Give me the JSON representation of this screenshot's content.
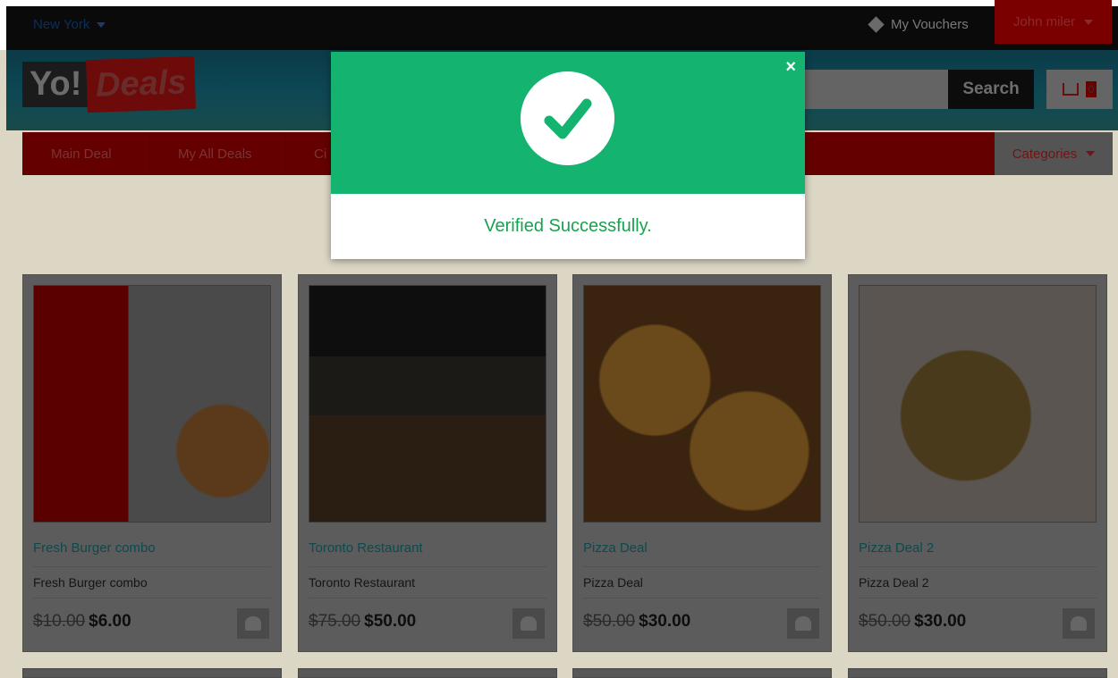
{
  "topbar": {
    "city": "New York",
    "vouchers": "My Vouchers",
    "user": "John miler"
  },
  "header": {
    "logo_yo": "Yo!",
    "logo_deals": "Deals",
    "search_label": "Search",
    "cart_count": "0"
  },
  "nav": {
    "items": [
      "Main Deal",
      "My All Deals",
      "Ci"
    ],
    "categories": "Categories"
  },
  "modal": {
    "close": "×",
    "message": "Verified Successfully."
  },
  "deals": [
    {
      "title": "Fresh Burger combo",
      "subtitle": "Fresh Burger combo",
      "old_price": "$10.00",
      "new_price": "$6.00"
    },
    {
      "title": "Toronto Restaurant",
      "subtitle": "Toronto Restaurant",
      "old_price": "$75.00",
      "new_price": "$50.00"
    },
    {
      "title": "Pizza Deal",
      "subtitle": "Pizza Deal",
      "old_price": "$50.00",
      "new_price": "$30.00"
    },
    {
      "title": "Pizza Deal 2",
      "subtitle": "Pizza Deal 2",
      "old_price": "$50.00",
      "new_price": "$30.00"
    }
  ],
  "colors": {
    "success": "#15b370",
    "brand_red": "#c40000",
    "overlay": "#000000"
  }
}
